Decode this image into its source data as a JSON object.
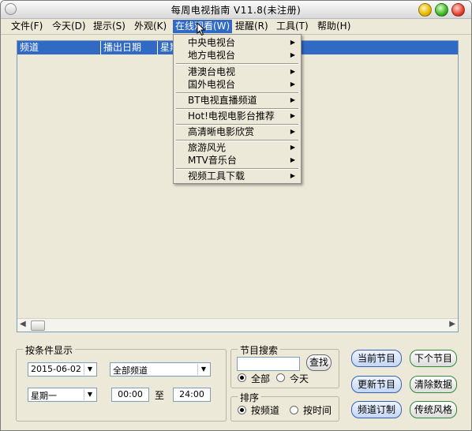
{
  "window": {
    "title": "每周电视指南 V11.8(未注册)"
  },
  "menu": [
    {
      "label": "文件(F)"
    },
    {
      "label": "今天(D)"
    },
    {
      "label": "提示(S)"
    },
    {
      "label": "外观(K)"
    },
    {
      "label": "在线观看(W)"
    },
    {
      "label": "提醒(R)"
    },
    {
      "label": "工具(T)"
    },
    {
      "label": "帮助(H)"
    }
  ],
  "listview": {
    "columns": [
      "频道",
      "播出日期",
      "星期"
    ]
  },
  "dropdown": {
    "items": [
      {
        "label": "中央电视台"
      },
      {
        "label": "地方电视台"
      },
      {
        "label": "港澳台电视"
      },
      {
        "label": "国外电视台"
      },
      {
        "label": "BT电视直播频道"
      },
      {
        "label": "Hot!电视电影台推荐"
      },
      {
        "label": "高清晰电影欣赏"
      },
      {
        "label": "旅游风光"
      },
      {
        "label": "MTV音乐台"
      },
      {
        "label": "视频工具下载"
      }
    ]
  },
  "filter": {
    "title": "按条件显示",
    "date": "2015-06-02",
    "channel": "全部频道",
    "weekday": "星期一",
    "time_from": "00:00",
    "to_label": "至",
    "time_to": "24:00"
  },
  "search": {
    "title": "节目搜索",
    "query": "",
    "button": "查找",
    "opt_all": "全部",
    "opt_today": "今天"
  },
  "sort": {
    "title": "排序",
    "opt_channel": "按频道",
    "opt_time": "按时间"
  },
  "buttons": {
    "current": "当前节目",
    "next": "下个节目",
    "update": "更新节目",
    "clear": "清除数据",
    "subscribe": "频道订制",
    "classic": "传统风格"
  },
  "colors": {
    "selection": "#316ac5",
    "face": "#ece9d8"
  }
}
